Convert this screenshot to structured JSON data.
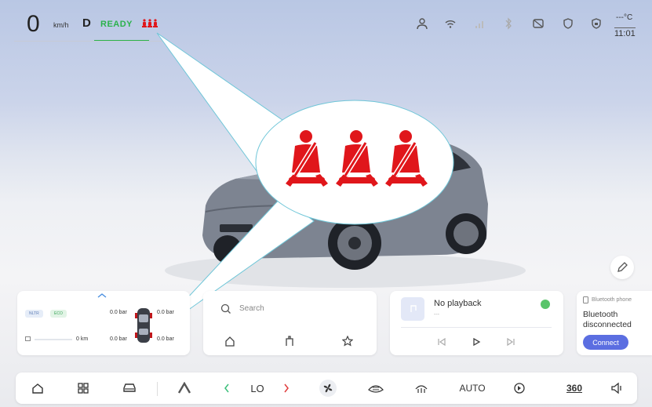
{
  "status": {
    "speed": "0",
    "speed_unit": "km/h",
    "gear": "D",
    "ready": "READY",
    "temperature": "---°C",
    "time": "11:01"
  },
  "vehicle_card": {
    "mode_badges": [
      "NLTR",
      "ECO"
    ],
    "range_label": "0 km",
    "tires": {
      "front_left": "0.0 bar",
      "front_right": "0.0 bar",
      "rear_left": "0.0 bar",
      "rear_right": "0.0 bar"
    }
  },
  "navigation": {
    "search_placeholder": "Search"
  },
  "media": {
    "title": "No playback",
    "subtitle": "---"
  },
  "bluetooth": {
    "header": "Bluetooth phone",
    "status_line1": "Bluetooth",
    "status_line2": "disconnected",
    "connect_label": "Connect"
  },
  "climate": {
    "temperature": "LO",
    "auto_label": "AUTO",
    "view_label": "360"
  },
  "colors": {
    "ready_green": "#2bb24c",
    "seatbelt_red": "#e0161b",
    "connect_blue": "#5b6ee1"
  }
}
